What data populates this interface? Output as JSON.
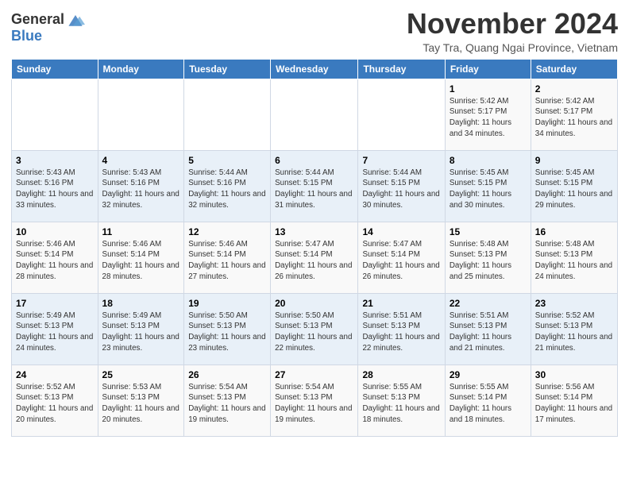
{
  "header": {
    "logo_general": "General",
    "logo_blue": "Blue",
    "month_title": "November 2024",
    "location": "Tay Tra, Quang Ngai Province, Vietnam"
  },
  "weekdays": [
    "Sunday",
    "Monday",
    "Tuesday",
    "Wednesday",
    "Thursday",
    "Friday",
    "Saturday"
  ],
  "weeks": [
    [
      {
        "day": "",
        "info": ""
      },
      {
        "day": "",
        "info": ""
      },
      {
        "day": "",
        "info": ""
      },
      {
        "day": "",
        "info": ""
      },
      {
        "day": "",
        "info": ""
      },
      {
        "day": "1",
        "info": "Sunrise: 5:42 AM\nSunset: 5:17 PM\nDaylight: 11 hours and 34 minutes."
      },
      {
        "day": "2",
        "info": "Sunrise: 5:42 AM\nSunset: 5:17 PM\nDaylight: 11 hours and 34 minutes."
      }
    ],
    [
      {
        "day": "3",
        "info": "Sunrise: 5:43 AM\nSunset: 5:16 PM\nDaylight: 11 hours and 33 minutes."
      },
      {
        "day": "4",
        "info": "Sunrise: 5:43 AM\nSunset: 5:16 PM\nDaylight: 11 hours and 32 minutes."
      },
      {
        "day": "5",
        "info": "Sunrise: 5:44 AM\nSunset: 5:16 PM\nDaylight: 11 hours and 32 minutes."
      },
      {
        "day": "6",
        "info": "Sunrise: 5:44 AM\nSunset: 5:15 PM\nDaylight: 11 hours and 31 minutes."
      },
      {
        "day": "7",
        "info": "Sunrise: 5:44 AM\nSunset: 5:15 PM\nDaylight: 11 hours and 30 minutes."
      },
      {
        "day": "8",
        "info": "Sunrise: 5:45 AM\nSunset: 5:15 PM\nDaylight: 11 hours and 30 minutes."
      },
      {
        "day": "9",
        "info": "Sunrise: 5:45 AM\nSunset: 5:15 PM\nDaylight: 11 hours and 29 minutes."
      }
    ],
    [
      {
        "day": "10",
        "info": "Sunrise: 5:46 AM\nSunset: 5:14 PM\nDaylight: 11 hours and 28 minutes."
      },
      {
        "day": "11",
        "info": "Sunrise: 5:46 AM\nSunset: 5:14 PM\nDaylight: 11 hours and 28 minutes."
      },
      {
        "day": "12",
        "info": "Sunrise: 5:46 AM\nSunset: 5:14 PM\nDaylight: 11 hours and 27 minutes."
      },
      {
        "day": "13",
        "info": "Sunrise: 5:47 AM\nSunset: 5:14 PM\nDaylight: 11 hours and 26 minutes."
      },
      {
        "day": "14",
        "info": "Sunrise: 5:47 AM\nSunset: 5:14 PM\nDaylight: 11 hours and 26 minutes."
      },
      {
        "day": "15",
        "info": "Sunrise: 5:48 AM\nSunset: 5:13 PM\nDaylight: 11 hours and 25 minutes."
      },
      {
        "day": "16",
        "info": "Sunrise: 5:48 AM\nSunset: 5:13 PM\nDaylight: 11 hours and 24 minutes."
      }
    ],
    [
      {
        "day": "17",
        "info": "Sunrise: 5:49 AM\nSunset: 5:13 PM\nDaylight: 11 hours and 24 minutes."
      },
      {
        "day": "18",
        "info": "Sunrise: 5:49 AM\nSunset: 5:13 PM\nDaylight: 11 hours and 23 minutes."
      },
      {
        "day": "19",
        "info": "Sunrise: 5:50 AM\nSunset: 5:13 PM\nDaylight: 11 hours and 23 minutes."
      },
      {
        "day": "20",
        "info": "Sunrise: 5:50 AM\nSunset: 5:13 PM\nDaylight: 11 hours and 22 minutes."
      },
      {
        "day": "21",
        "info": "Sunrise: 5:51 AM\nSunset: 5:13 PM\nDaylight: 11 hours and 22 minutes."
      },
      {
        "day": "22",
        "info": "Sunrise: 5:51 AM\nSunset: 5:13 PM\nDaylight: 11 hours and 21 minutes."
      },
      {
        "day": "23",
        "info": "Sunrise: 5:52 AM\nSunset: 5:13 PM\nDaylight: 11 hours and 21 minutes."
      }
    ],
    [
      {
        "day": "24",
        "info": "Sunrise: 5:52 AM\nSunset: 5:13 PM\nDaylight: 11 hours and 20 minutes."
      },
      {
        "day": "25",
        "info": "Sunrise: 5:53 AM\nSunset: 5:13 PM\nDaylight: 11 hours and 20 minutes."
      },
      {
        "day": "26",
        "info": "Sunrise: 5:54 AM\nSunset: 5:13 PM\nDaylight: 11 hours and 19 minutes."
      },
      {
        "day": "27",
        "info": "Sunrise: 5:54 AM\nSunset: 5:13 PM\nDaylight: 11 hours and 19 minutes."
      },
      {
        "day": "28",
        "info": "Sunrise: 5:55 AM\nSunset: 5:13 PM\nDaylight: 11 hours and 18 minutes."
      },
      {
        "day": "29",
        "info": "Sunrise: 5:55 AM\nSunset: 5:14 PM\nDaylight: 11 hours and 18 minutes."
      },
      {
        "day": "30",
        "info": "Sunrise: 5:56 AM\nSunset: 5:14 PM\nDaylight: 11 hours and 17 minutes."
      }
    ]
  ]
}
